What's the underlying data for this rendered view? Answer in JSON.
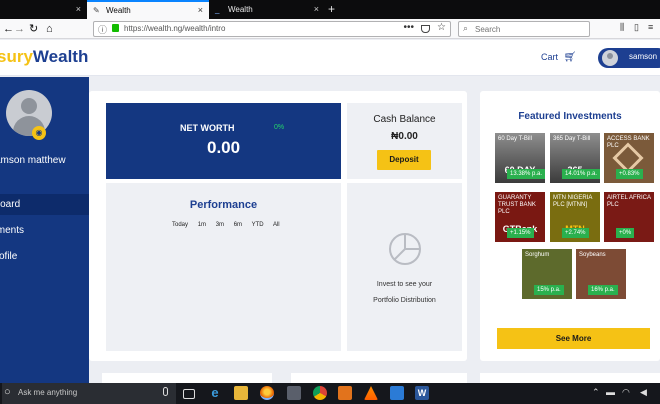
{
  "browser": {
    "tabs": [
      {
        "label": "",
        "close": "×"
      },
      {
        "label": "Wealth",
        "close": "×"
      },
      {
        "label": "Wealth",
        "close": "×"
      }
    ],
    "new_tab": "+",
    "url": "https://wealth.ng/wealth/intro",
    "search_placeholder": "Search",
    "url_more": "•••"
  },
  "header": {
    "logo_part1": "sury",
    "logo_part2": "Wealth",
    "cart_label": "Cart",
    "username": "samson"
  },
  "sidebar": {
    "user_name": "amson matthew",
    "items": [
      {
        "label": "hboard",
        "active": true
      },
      {
        "label": "stments",
        "active": false
      },
      {
        "label": "Profile",
        "active": false
      }
    ]
  },
  "networth": {
    "label": "NET WORTH",
    "change": "0%",
    "value": "0.00"
  },
  "cash_balance": {
    "title": "Cash Balance",
    "value": "₦0.00",
    "deposit_label": "Deposit"
  },
  "performance": {
    "title": "Performance",
    "ranges": [
      "Today",
      "1m",
      "3m",
      "6m",
      "YTD",
      "All"
    ]
  },
  "portfolio": {
    "line1": "Invest to see your",
    "line2": "Portfolio Distribution"
  },
  "featured": {
    "title": "Featured Investments",
    "items": [
      {
        "name": "60 Day T-Bill",
        "art": "60 DAY",
        "rate": "13.38% p.a."
      },
      {
        "name": "365 Day T-Bill",
        "art": "365",
        "rate": "14.01% p.a."
      },
      {
        "name": "ACCESS BANK PLC",
        "art": "",
        "rate": "+0.83%"
      },
      {
        "name": "GUARANTY TRUST BANK PLC",
        "art": "GTBank",
        "rate": "+1.15%"
      },
      {
        "name": "MTN NIGERIA PLC [MTNN]",
        "art": "MTN",
        "rate": "+2.74%"
      },
      {
        "name": "AIRTEL AFRICA PLC",
        "art": "",
        "rate": "+0%"
      },
      {
        "name": "Sorghum",
        "art": "",
        "rate": "15% p.a."
      },
      {
        "name": "Soybeans",
        "art": "",
        "rate": "16% p.a."
      }
    ],
    "see_more": "See More"
  },
  "taskbar": {
    "search_placeholder": "Ask me anything"
  }
}
